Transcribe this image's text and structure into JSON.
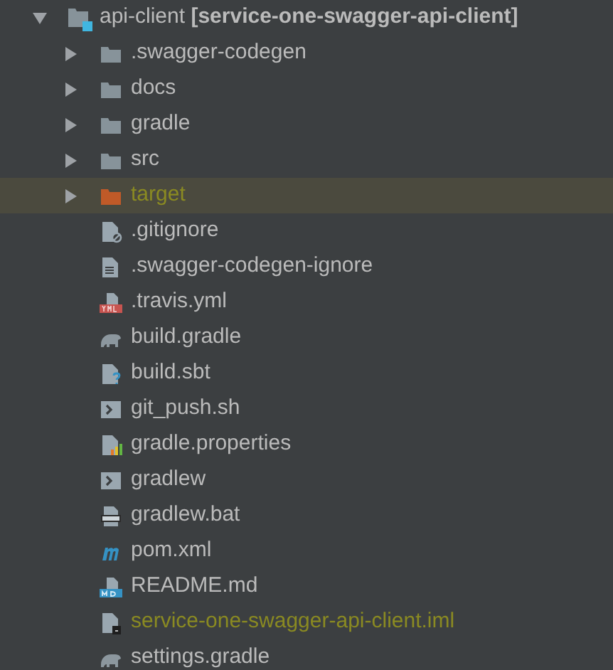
{
  "tree": {
    "label": "api-client **[service-one-swagger-api-client]**",
    "expanded": true,
    "selected": false,
    "children": [
      {
        "kind": "folder",
        "label": ".swagger-codegen",
        "expanded": false,
        "selected": false,
        "ignored": false
      },
      {
        "kind": "folder",
        "label": "docs",
        "expanded": false,
        "selected": false,
        "ignored": false
      },
      {
        "kind": "folder",
        "label": "gradle",
        "expanded": false,
        "selected": false,
        "ignored": false
      },
      {
        "kind": "folder",
        "label": "src",
        "expanded": false,
        "selected": false,
        "ignored": false
      },
      {
        "kind": "excluded-folder",
        "label": "target",
        "expanded": false,
        "selected": true,
        "ignored": true
      },
      {
        "kind": "ignore",
        "label": ".gitignore",
        "selected": false,
        "ignored": false
      },
      {
        "kind": "text",
        "label": ".swagger-codegen-ignore",
        "selected": false,
        "ignored": false
      },
      {
        "kind": "yml",
        "label": ".travis.yml",
        "selected": false,
        "ignored": false
      },
      {
        "kind": "gradle",
        "label": "build.gradle",
        "selected": false,
        "ignored": false
      },
      {
        "kind": "unknown",
        "label": "build.sbt",
        "selected": false,
        "ignored": false
      },
      {
        "kind": "shell",
        "label": "git_push.sh",
        "selected": false,
        "ignored": false
      },
      {
        "kind": "properties",
        "label": "gradle.properties",
        "selected": false,
        "ignored": false
      },
      {
        "kind": "shell",
        "label": "gradlew",
        "selected": false,
        "ignored": false
      },
      {
        "kind": "bat",
        "label": "gradlew.bat",
        "selected": false,
        "ignored": false
      },
      {
        "kind": "maven",
        "label": "pom.xml",
        "selected": false,
        "ignored": false
      },
      {
        "kind": "markdown",
        "label": "README.md",
        "selected": false,
        "ignored": false
      },
      {
        "kind": "iml",
        "label": "service-one-swagger-api-client.iml",
        "selected": false,
        "ignored": true
      },
      {
        "kind": "gradle",
        "label": "settings.gradle",
        "selected": false,
        "ignored": false
      }
    ]
  }
}
